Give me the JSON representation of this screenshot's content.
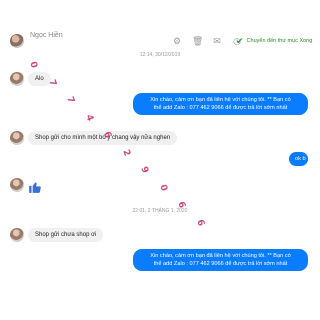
{
  "header": {
    "contact_name": "Ngọc Hiền",
    "done_label": "Chuyển đến thư mục Xong",
    "icons": [
      "gear-icon",
      "trash-icon",
      "envelope-icon",
      "clock-icon"
    ]
  },
  "timestamps": {
    "first": "12:14, 30/12/2019",
    "second": "22:01, 2 THÁNG 1, 2020"
  },
  "messages": {
    "in_1": "Alo",
    "out_1_line1": "Xin chào, cảm ơn bạn đã liên hệ với chúng tôi.  ** Bạn có",
    "out_1_line2": "thể add Zalo : 077 462 9066 để được trả lời sớm nhất",
    "in_2": "Shop gửi cho mình một bó y chang vậy nữa nghen",
    "out_2": "ok b",
    "in_3_icon": "thumbs-up-icon",
    "in_4": "Shop gửi chưa shop ơi",
    "out_3_line1": "Xin chào, cảm ơn bạn đã liên hệ với chúng tôi.  ** Bạn có",
    "out_3_line2": "thể add Zalo : 077 462 9066 để được trả lời sớm nhất"
  },
  "watermark": {
    "text": "0774629066",
    "color": "#d0497f"
  }
}
